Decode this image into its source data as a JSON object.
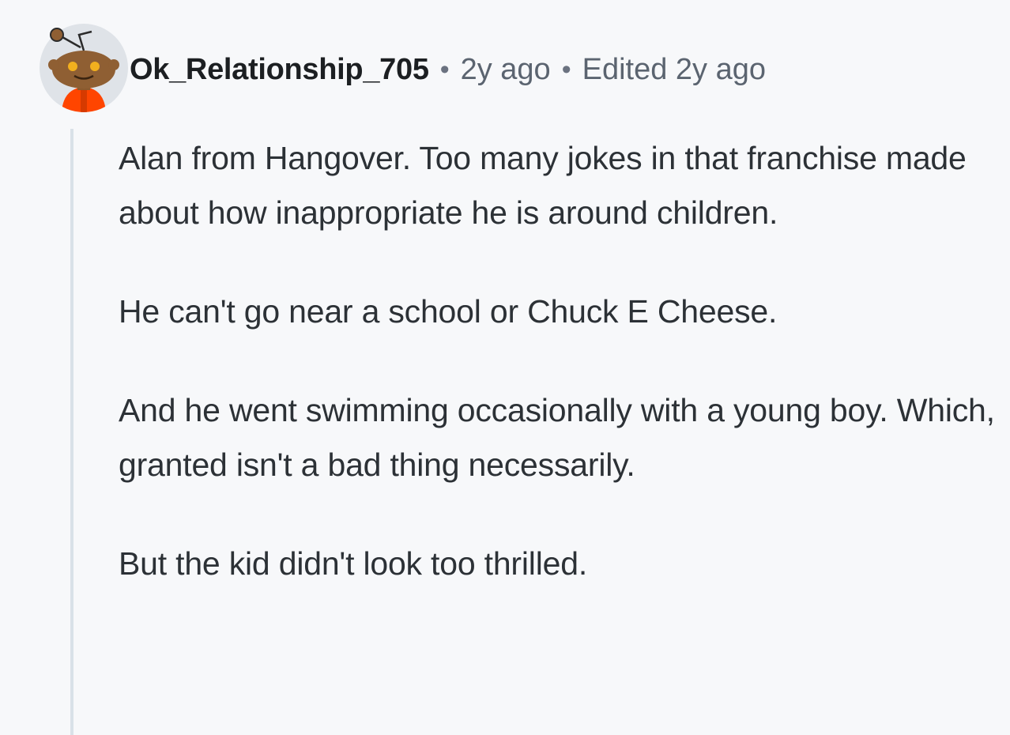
{
  "comment": {
    "author": "Ok_Relationship_705",
    "separator": "•",
    "age": "2y ago",
    "edited": "Edited 2y ago",
    "paragraphs": [
      "Alan from Hangover. Too many jokes in that franchise made about how inappropriate he is around children.",
      "He can't go near a school or Chuck E Cheese.",
      "And he went swimming occasionally with a young boy. Which, granted isn't a bad thing necessarily.",
      "But the kid didn't look too thrilled."
    ]
  },
  "icons": {
    "avatar": "snoo-avatar-icon"
  },
  "colors": {
    "background": "#f7f8fa",
    "thread_line": "#d9e1e8",
    "avatar_bg": "#dfe3e8",
    "shirt": "#ff4500"
  }
}
